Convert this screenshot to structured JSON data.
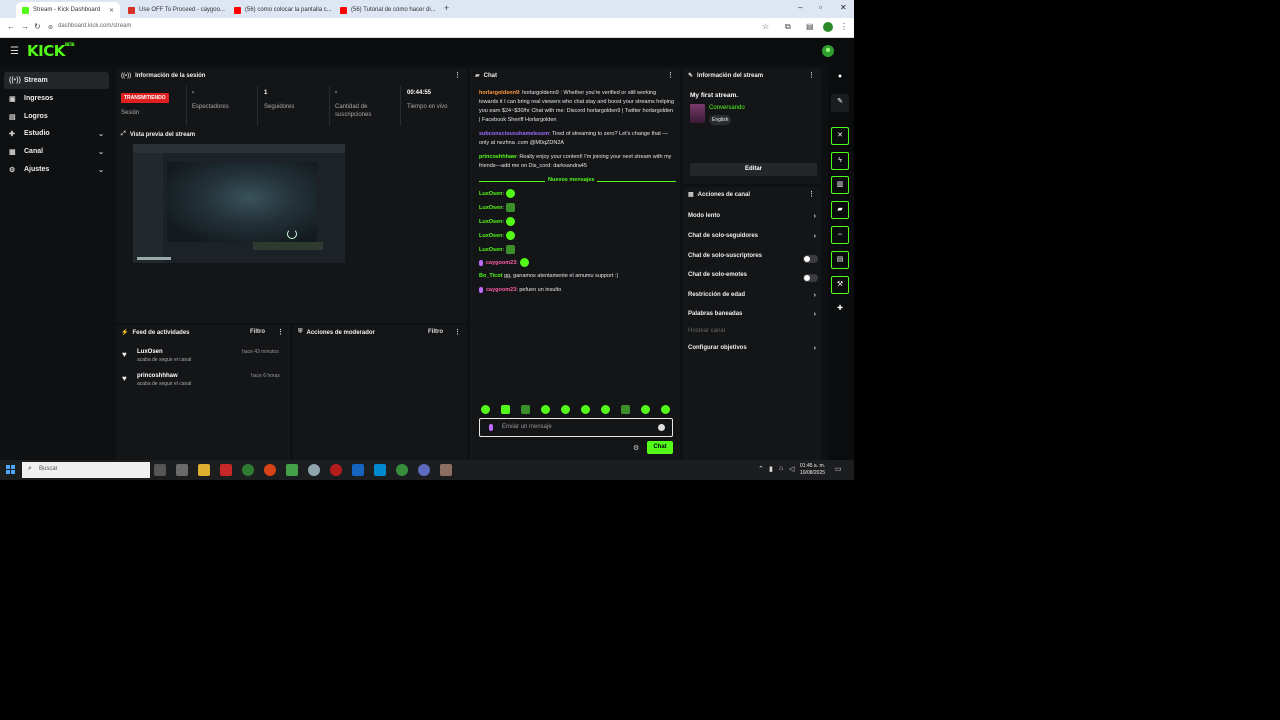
{
  "browser": {
    "tabs": [
      {
        "title": "Stream - Kick Dashboard",
        "color": "#53fc18",
        "active": true
      },
      {
        "title": "Use OFF To Proceed - caygoo...",
        "color": "#d93025",
        "active": false
      },
      {
        "title": "(56) como colocar la pantalla c...",
        "color": "#ff0000",
        "active": false
      },
      {
        "title": "(56) Tutorial de cómo hacer di...",
        "color": "#ff0000",
        "active": false
      }
    ],
    "new_tab": "+",
    "url": "dashboard.kick.com/stream"
  },
  "kick": {
    "logo": "KICK",
    "logo_sup": "BETA"
  },
  "sidebar": {
    "items": [
      {
        "label": "Stream",
        "icon": "((•))",
        "active": true,
        "chevron": false
      },
      {
        "label": "Ingresos",
        "icon": "▣",
        "active": false,
        "chevron": false
      },
      {
        "label": "Logros",
        "icon": "▤",
        "active": false,
        "chevron": false
      },
      {
        "label": "Estudio",
        "icon": "✚",
        "active": false,
        "chevron": true
      },
      {
        "label": "Canal",
        "icon": "▦",
        "active": false,
        "chevron": true
      },
      {
        "label": "Ajustes",
        "icon": "⚙",
        "active": false,
        "chevron": true
      }
    ]
  },
  "session": {
    "title": "Información de la sesión",
    "live_badge": "TRANSMITIENDO",
    "session_label": "Sesión",
    "stats": [
      {
        "value": "-",
        "label": "Espectadores"
      },
      {
        "value": "1",
        "label": "Seguidores"
      },
      {
        "value": "-",
        "label": "Cantidad de suscripciones"
      },
      {
        "value": "00:44:55",
        "label": "Tiempo en vivo"
      }
    ]
  },
  "preview": {
    "title": "Vista previa del stream"
  },
  "feed": {
    "title": "Feed de actividades",
    "filter": "Filtro",
    "items": [
      {
        "name": "LuxOsen",
        "action": "acaba de seguir el canal",
        "time": "hace 43 minutos"
      },
      {
        "name": "princoshhhaw",
        "action": "acaba de seguir el canal",
        "time": "hace 6 horas"
      }
    ]
  },
  "mod": {
    "title": "Acciones de moderador",
    "filter": "Filtro"
  },
  "chat": {
    "title": "Chat",
    "messages": [
      {
        "user": "horlargoldenn9",
        "sep": ": ",
        "text": "horlargoldenn9 : Whether you're verified or still working towards it I can bring real viewers who chat stay and boost your streams helping you earn $24~$30/hr Chat with me: Discord horlargolden9 | Twitter horlargolden | Facebook Sheriff Horlargolden",
        "color": "orange"
      },
      {
        "user": "subconsciousshamelessm",
        "sep": ": ",
        "text": "Tired of streaming to zero? Let's change that — only at nezhna .com @M0qZDN2A",
        "color": "purple"
      },
      {
        "user": "princoshhhaw",
        "sep": ": ",
        "text": ": Really enjoy your content! I'm joining your next stream with my friends—add me on Dis_cord: darksandra45",
        "color": "green"
      }
    ],
    "new_messages": "Nuevos mensajes",
    "emote_messages": [
      {
        "user": "LuxOsen",
        "sep": ":"
      },
      {
        "user": "LuxOsen",
        "sep": ":"
      },
      {
        "user": "LuxOsen",
        "sep": ":"
      },
      {
        "user": "LuxOsen",
        "sep": ":"
      },
      {
        "user": "LuxOsen",
        "sep": ":"
      }
    ],
    "later_messages": [
      {
        "user": "caygoom23",
        "sep": ":",
        "text": "",
        "color": "pink",
        "mic": true,
        "emote": true
      },
      {
        "user": "Bo_Ticot",
        "sep": " ",
        "text": "gg, ganamos atentamente el amumu support :)",
        "color": "green",
        "mic": false,
        "emote": false
      },
      {
        "user": "caygoom23",
        "sep": ":",
        "text": " pefuen un insulto",
        "color": "pink",
        "mic": true,
        "emote": false
      }
    ],
    "input_placeholder": "Enviar un mensaje",
    "send_label": "Chat"
  },
  "stream_info": {
    "title": "Información del stream",
    "stream_title": "My first stream.",
    "category": "Conversando",
    "language": "English",
    "edit_label": "Editar"
  },
  "channel_actions": {
    "title": "Acciones de canal",
    "items": [
      {
        "label": "Modo lento",
        "control": "chevron"
      },
      {
        "label": "Chat de solo-seguidores",
        "control": "chevron"
      },
      {
        "label": "Chat de solo-suscriptores",
        "control": "toggle"
      },
      {
        "label": "Chat de solo-emotes",
        "control": "toggle"
      },
      {
        "label": "Restricción de edad",
        "control": "chevron"
      },
      {
        "label": "Palabras baneadas",
        "control": "chevron"
      },
      {
        "label": "Hostear canal",
        "control": "disabled"
      },
      {
        "label": "Configurar objetivos",
        "control": "chevron"
      }
    ]
  },
  "taskbar": {
    "search_placeholder": "Buscar",
    "time": "01:45 a. m.",
    "date": "10/08/2025"
  }
}
